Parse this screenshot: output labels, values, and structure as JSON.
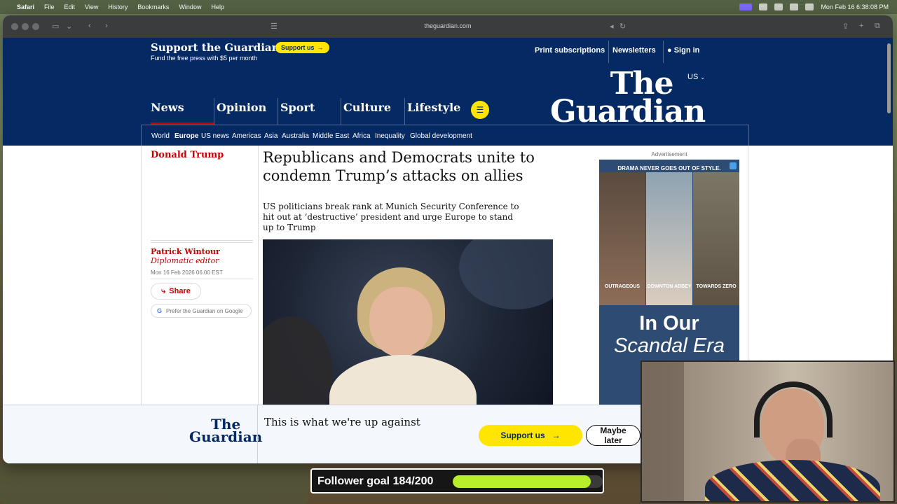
{
  "menubar": {
    "app": "Safari",
    "items": [
      "File",
      "Edit",
      "View",
      "History",
      "Bookmarks",
      "Window",
      "Help"
    ],
    "clock": "Mon Feb 16  6:38:08 PM"
  },
  "browser": {
    "url": "theguardian.com"
  },
  "guardian": {
    "support_title": "Support the Guardian",
    "support_sub": "Fund the free press with $5 per month",
    "support_button": "Support us",
    "print_subscriptions": "Print subscriptions",
    "newsletters": "Newsletters",
    "sign_in": "Sign in",
    "edition": "US",
    "logo_line1": "The",
    "logo_line2": "Guardian",
    "pillars": [
      "News",
      "Opinion",
      "Sport",
      "Culture",
      "Lifestyle"
    ],
    "subnav": [
      "World",
      "Europe",
      "US news",
      "Americas",
      "Asia",
      "Australia",
      "Middle East",
      "Africa",
      "Inequality",
      "Global development"
    ]
  },
  "article": {
    "kicker": "Donald Trump",
    "headline": "Republicans and Democrats unite to condemn Trump’s attacks on allies",
    "standfirst": "US politicians break rank at Munich Security Conference to hit out at ‘destructive’ president and urge Europe to stand up to Trump",
    "author": "Patrick Wintour",
    "role": "Diplomatic editor",
    "date": "Mon 16 Feb 2026 06.00 EST",
    "share": "Share",
    "google": "Prefer the Guardian on Google"
  },
  "ad": {
    "label": "Advertisement",
    "tagline": "DRAMA NEVER GOES OUT OF STYLE.",
    "captions": [
      "OUTRAGEOUS",
      "DOWNTON ABBEY",
      "TOWARDS ZERO"
    ],
    "headline1": "In Our",
    "headline2": "Scandal Era"
  },
  "banner": {
    "logo_line1": "The",
    "logo_line2": "Guardian",
    "text": "This is what we're up against",
    "support": "Support us",
    "maybe_later": "Maybe later"
  },
  "follower_goal": {
    "text": "Follower goal 184/200",
    "current": 184,
    "target": 200,
    "bar_color": "#b7ef2b"
  },
  "colors": {
    "guardian_blue": "#052962",
    "guardian_yellow": "#ffe500",
    "news_red": "#c70000"
  }
}
